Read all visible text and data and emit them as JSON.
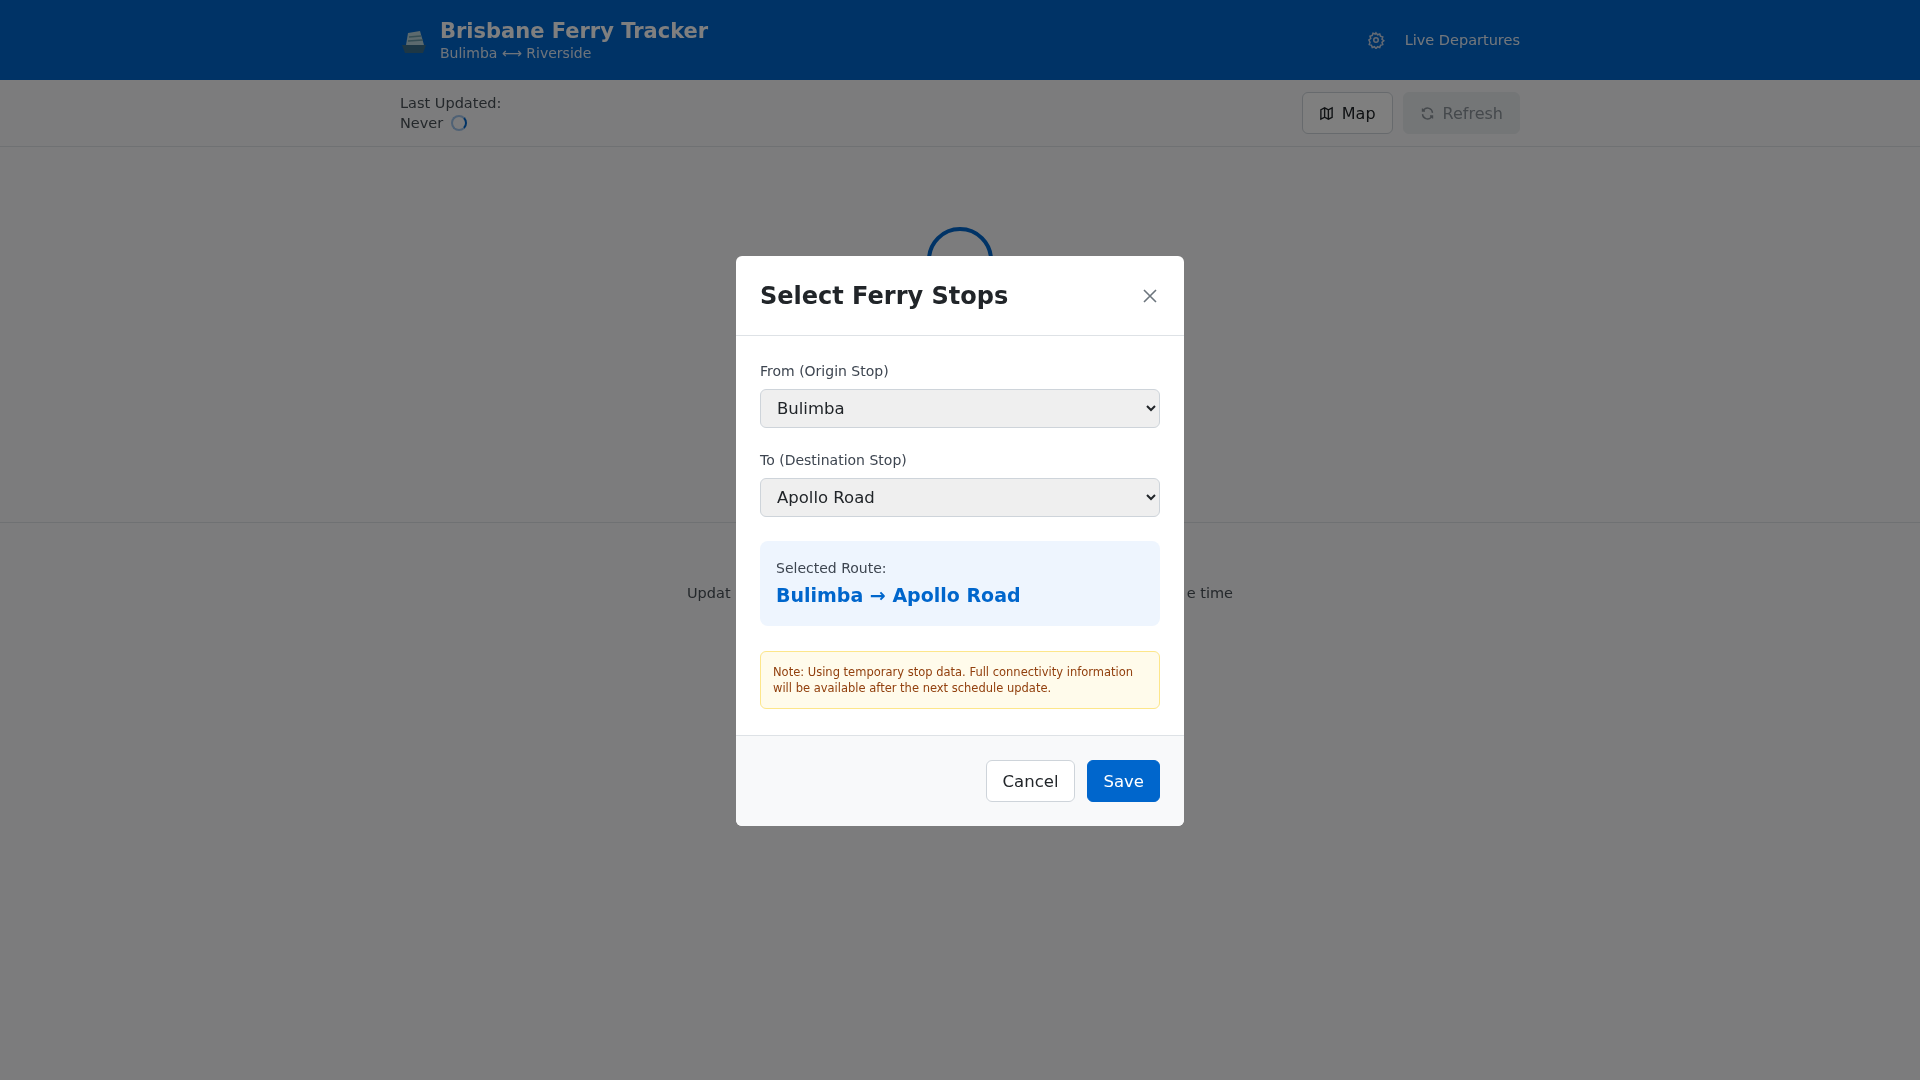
{
  "header": {
    "title": "Brisbane Ferry Tracker",
    "subtitle": "Bulimba ⟷ Riverside",
    "nav_link": "Live Departures"
  },
  "toolbar": {
    "last_updated_label": "Last Updated:",
    "last_updated_value": "Never",
    "loading": true,
    "buttons": [
      {
        "label": "Map",
        "kind": "map",
        "disabled": false
      },
      {
        "label": "Refresh",
        "kind": "refresh",
        "disabled": true
      }
    ]
  },
  "background": {
    "loading": true,
    "hint_left": "Updat",
    "hint_right": "e time"
  },
  "dialog": {
    "title": "Select Ferry Stops",
    "fields": [
      {
        "label": "From (Origin Stop)",
        "value": "Bulimba"
      },
      {
        "label": "To (Destination Stop)",
        "value": "Apollo Road"
      }
    ],
    "route_label": "Selected Route:",
    "route_value": "Bulimba → Apollo Road",
    "note": "Note: Using temporary stop data. Full connectivity information will be available after the next schedule update.",
    "buttons": [
      {
        "label": "Cancel",
        "kind": "secondary"
      },
      {
        "label": "Save",
        "kind": "primary"
      }
    ]
  }
}
